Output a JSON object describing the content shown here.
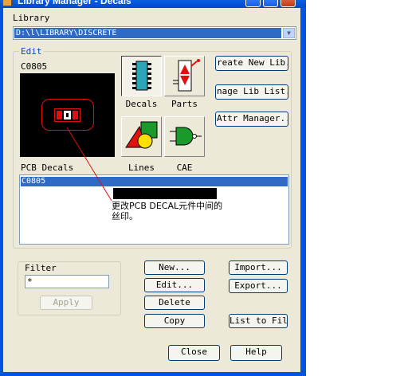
{
  "window": {
    "title": "Library Manager - Decals"
  },
  "library": {
    "label": "Library",
    "value": "D:\\l\\LIBRARY\\DISCRETE"
  },
  "edit": {
    "group_label": "Edit",
    "current_item": "C0805",
    "modes": {
      "decals": "Decals",
      "parts": "Parts",
      "lines": "Lines",
      "cae": "CAE"
    },
    "side_buttons": {
      "create_lib": "reate New Lib..",
      "manage_lib": "nage Lib List..",
      "attr_manager": "Attr Manager..."
    },
    "list_label": "PCB Decals",
    "list_items": [
      "C0805"
    ]
  },
  "annotation": {
    "text": "更改PCB DECAL元件中间的丝印。",
    "color": "#e01010"
  },
  "filter": {
    "label": "Filter",
    "value": "*",
    "apply_label": "Apply"
  },
  "buttons": {
    "new": "New...",
    "edit": "Edit...",
    "delete": "Delete",
    "copy": "Copy",
    "import": "Import...",
    "export": "Export...",
    "list_to_file": "List to File",
    "close": "Close",
    "help": "Help"
  },
  "colors": {
    "selection": "#316ac5",
    "title_bar": "#0054e3",
    "dialog_bg": "#ece9d8"
  }
}
